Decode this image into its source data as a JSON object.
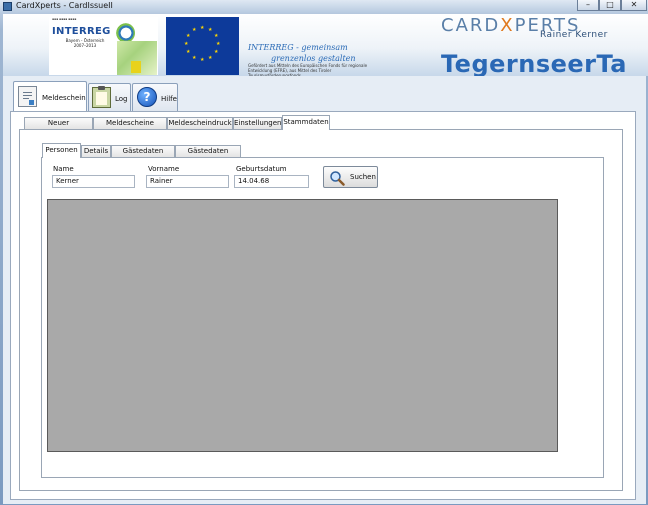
{
  "window": {
    "title": "CardXperts - CardIssueII",
    "controls": [
      "–",
      "□",
      "✕"
    ]
  },
  "banner": {
    "interreg_word": "INTERREG",
    "interreg_sub": "Bayern - Österreich 2007–2013",
    "slogan_line1": "INTERREG - gemeinsam",
    "slogan_line2": "grenzenlos gestalten",
    "funding": "Gefördert aus Mitteln des Europäischen Fonds für regionale Entwicklung (EFRE), aus Mittel des Tiroler Tourismusförderungsfonds",
    "cardx_left": "CARD",
    "cardx_mid": "X",
    "cardx_right": "PERTS",
    "cardx_sub": "Rainer Kerner",
    "tegernsee": "TegernseerTa"
  },
  "main_tabs": [
    {
      "label": "Meldeschein",
      "icon": "document-icon",
      "active": true
    },
    {
      "label": "Log",
      "icon": "clipboard-icon",
      "active": false
    },
    {
      "label": "Hilfe",
      "icon": "help-icon",
      "active": false
    }
  ],
  "tabs": [
    {
      "label": "Neuer Meldeschein",
      "active": false
    },
    {
      "label": "Meldescheine finden",
      "active": false
    },
    {
      "label": "Meldescheindruck",
      "active": false
    },
    {
      "label": "Einstellungen",
      "active": false
    },
    {
      "label": "Stammdaten",
      "active": true
    }
  ],
  "subtabs": [
    {
      "label": "Personen",
      "active": true
    },
    {
      "label": "Details",
      "active": false
    },
    {
      "label": "Gästedaten Import",
      "active": false
    },
    {
      "label": "Gästedaten Export",
      "active": false
    }
  ],
  "form": {
    "name_label": "Name",
    "name_value": "Kerner",
    "vorname_label": "Vorname",
    "vorname_value": "Rainer",
    "geburtsdatum_label": "Geburtsdatum",
    "geburtsdatum_value": "14.04.68",
    "search_label": "Suchen"
  },
  "colors": {
    "accent": "#2a68b5",
    "cardx_orange": "#e07a1f",
    "grid_gray": "#a9a9a9"
  }
}
